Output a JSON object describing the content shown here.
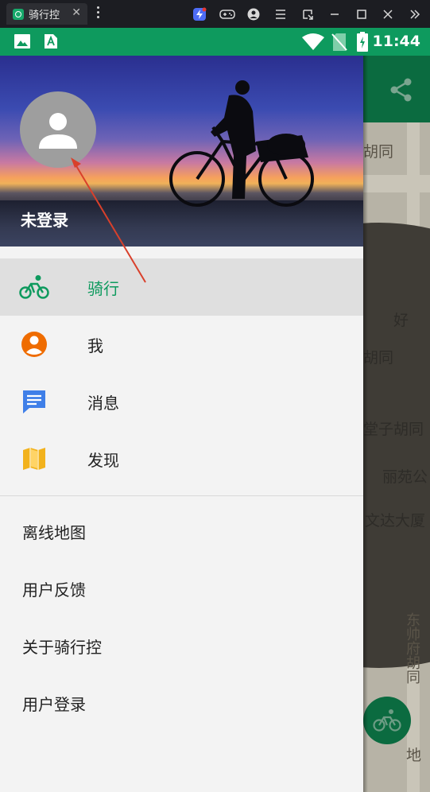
{
  "emulator": {
    "tab_title": "骑行控",
    "tab_close": "✕",
    "icons": [
      "bolt-icon",
      "gamepad-icon",
      "account-icon",
      "menu-icon",
      "popout-icon",
      "minimize-icon",
      "maximize-icon",
      "close-icon",
      "expand-icon"
    ]
  },
  "status_bar": {
    "time": "11:44",
    "icons": [
      "image-icon",
      "text-icon",
      "wifi-icon",
      "no-sim-icon",
      "battery-charging-icon"
    ],
    "color": "#0e9a5e"
  },
  "drawer": {
    "user_name": "未登录",
    "menu": [
      {
        "label": "骑行",
        "icon": "bike-icon",
        "active": true,
        "color": "#0e9a5e"
      },
      {
        "label": "我",
        "icon": "person-circle-icon",
        "active": false,
        "color": "#ef6c00"
      },
      {
        "label": "消息",
        "icon": "message-icon",
        "active": false,
        "color": "#3f7fe8"
      },
      {
        "label": "发现",
        "icon": "map-icon",
        "active": false,
        "color": "#f2b21c"
      }
    ],
    "secondary": [
      {
        "label": "离线地图"
      },
      {
        "label": "用户反馈"
      },
      {
        "label": "关于骑行控"
      },
      {
        "label": "用户登录"
      }
    ]
  },
  "map": {
    "labels": [
      "胡同",
      "好",
      "胡同",
      "堂子胡同",
      "丽苑公",
      "文达大厦",
      "东帅府胡同",
      "地"
    ],
    "share_icon": "share-icon",
    "fab_icon": "bike-icon"
  }
}
